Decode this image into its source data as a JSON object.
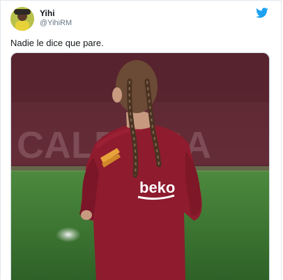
{
  "user": {
    "display_name": "Yihi",
    "handle": "@YihiRM"
  },
  "tweet": {
    "text": "Nadie le dice que pare."
  },
  "media": {
    "jersey_sponsor": "beko",
    "background_text": "CALDEIRA"
  },
  "colors": {
    "twitter_blue": "#1da1f2",
    "jersey_red": "#8e1b2e",
    "pitch_green": "#3e7a34"
  },
  "icons": {
    "brand": "twitter-bird-icon"
  }
}
